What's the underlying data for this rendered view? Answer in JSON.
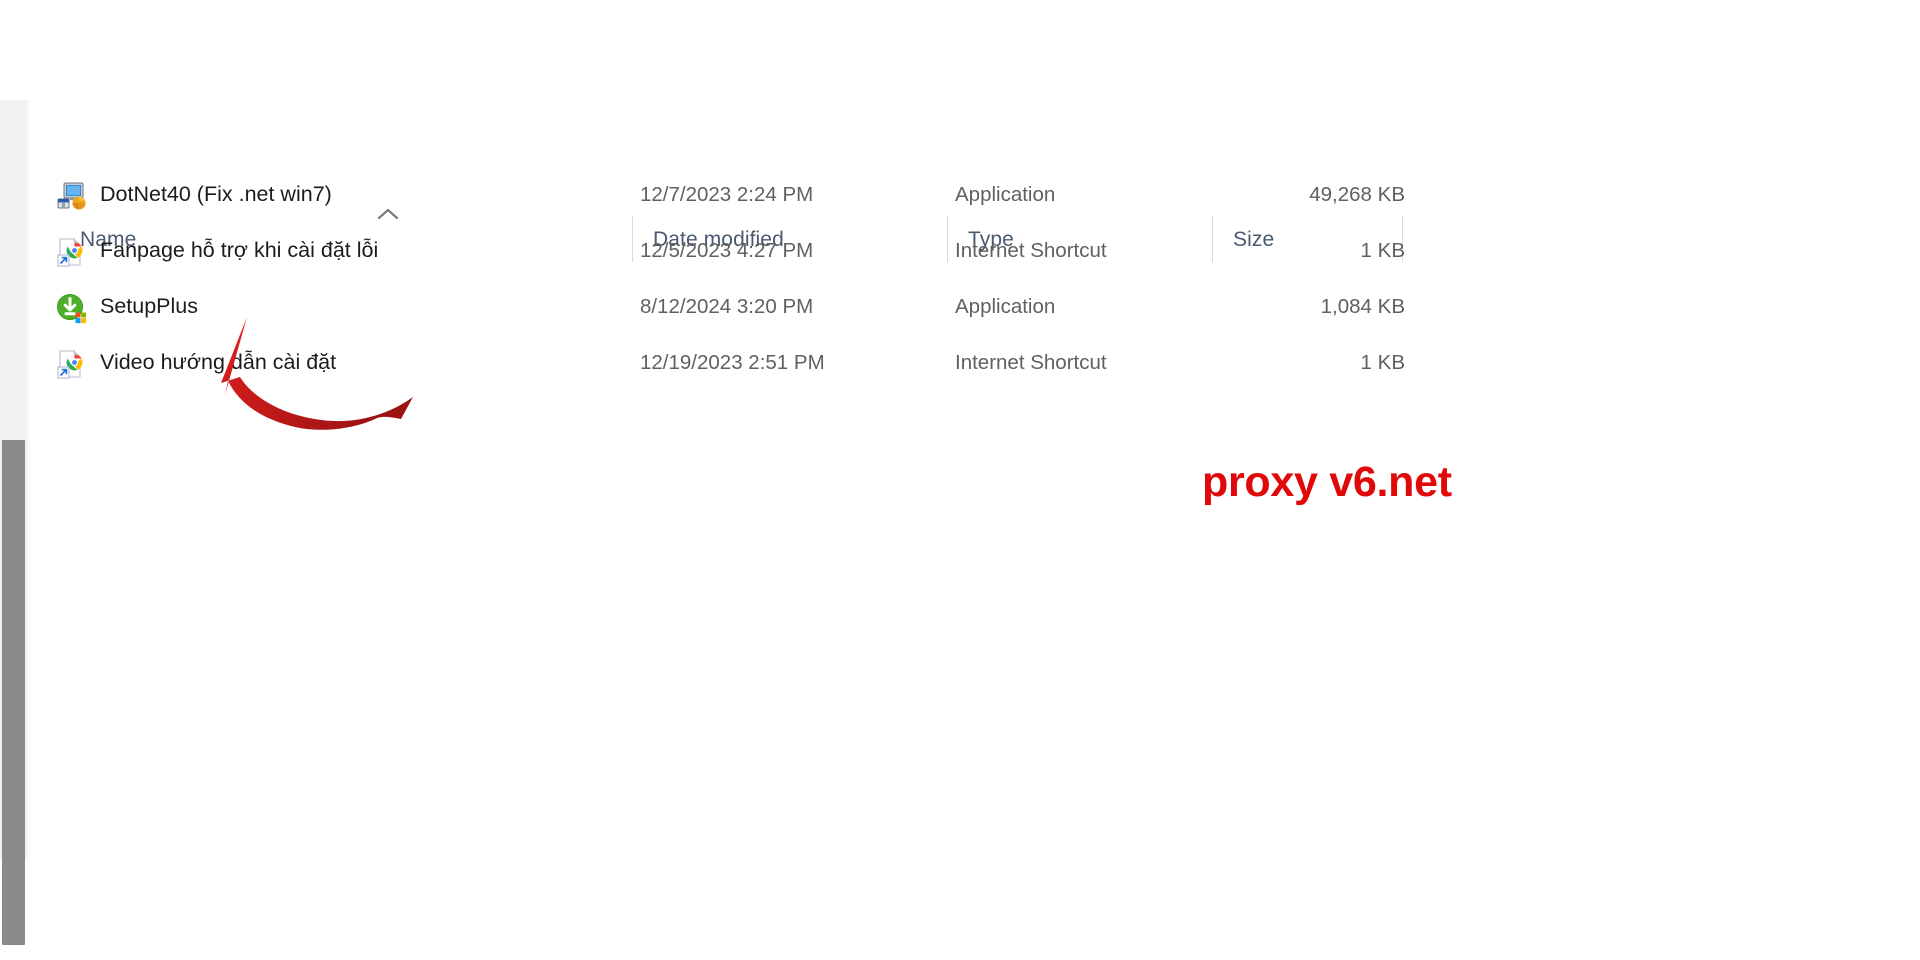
{
  "window": {
    "background_color": "#ffffff"
  },
  "scrollbar": {
    "name": "vertical-scrollbar",
    "track_color": "#f1f1f1",
    "thumb_color": "#8a8a8a"
  },
  "file_list": {
    "sort": {
      "column": "Name",
      "direction": "ascending",
      "icon": "chevron-up-icon"
    },
    "columns": [
      {
        "label": "Name",
        "key": "name"
      },
      {
        "label": "Date modified",
        "key": "date"
      },
      {
        "label": "Type",
        "key": "type"
      },
      {
        "label": "Size",
        "key": "size"
      }
    ],
    "rows": [
      {
        "icon": "windows-installer-icon",
        "name": "DotNet40 (Fix .net win7)",
        "date": "12/7/2023 2:24 PM",
        "type": "Application",
        "size": "49,268 KB"
      },
      {
        "icon": "internet-shortcut-icon",
        "name": "Fanpage hỗ trợ khi cài đặt lỗi",
        "date": "12/5/2023 4:27 PM",
        "type": "Internet Shortcut",
        "size": "1 KB"
      },
      {
        "icon": "green-download-installer-icon",
        "name": "SetupPlus",
        "date": "8/12/2024 3:20 PM",
        "type": "Application",
        "size": "1,084 KB"
      },
      {
        "icon": "internet-shortcut-icon",
        "name": "Video hướng dẫn cài đặt",
        "date": "12/19/2023 2:51 PM",
        "type": "Internet Shortcut",
        "size": "1 KB"
      }
    ]
  },
  "annotations": {
    "arrow": {
      "name": "red-curved-arrow",
      "color": "#c41a1a",
      "points_to": "SetupPlus"
    },
    "watermark": {
      "text": "proxy v6.net",
      "color": "#e00808"
    }
  }
}
